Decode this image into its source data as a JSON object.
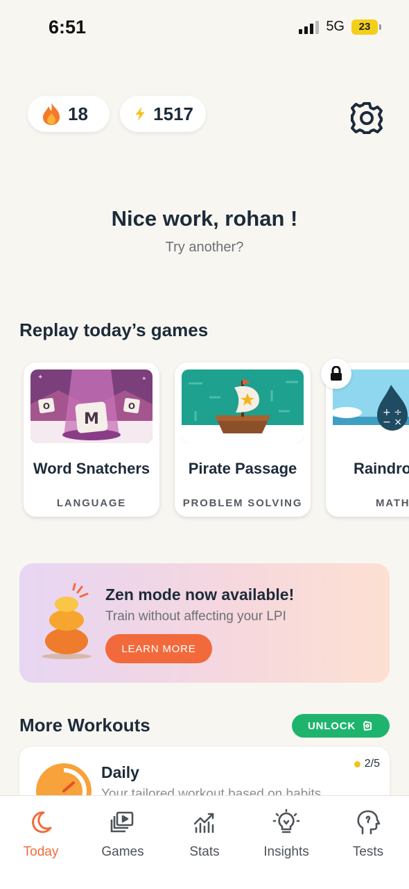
{
  "status_bar": {
    "time": "6:51",
    "network": "5G",
    "battery": "23"
  },
  "header": {
    "streak": "18",
    "lpi": "1517"
  },
  "greeting": {
    "title": "Nice work, rohan !",
    "subtitle": "Try another?"
  },
  "replay": {
    "title": "Replay today’s games",
    "games": [
      {
        "name": "Word Snatchers",
        "category": "LANGUAGE",
        "tile_letters": [
          "M",
          "O",
          "O"
        ]
      },
      {
        "name": "Pirate Passage",
        "category": "PROBLEM SOLVING"
      },
      {
        "name": "Raindro",
        "category": "MATH",
        "locked": true
      }
    ]
  },
  "zen": {
    "title": "Zen mode now available!",
    "subtitle": "Train without affecting your LPI",
    "button": "LEARN MORE"
  },
  "workouts": {
    "title": "More Workouts",
    "unlock_label": "UNLOCK",
    "items": [
      {
        "title": "Daily",
        "subtitle": "Your tailored workout based on habits",
        "progress": "2/5"
      }
    ]
  },
  "nav": {
    "tabs": [
      {
        "label": "Today",
        "active": true
      },
      {
        "label": "Games"
      },
      {
        "label": "Stats"
      },
      {
        "label": "Insights"
      },
      {
        "label": "Tests"
      }
    ]
  },
  "colors": {
    "accent": "#f26a3b",
    "unlock": "#1fb46e",
    "text": "#1c2b3a",
    "background": "#f8f6f1"
  }
}
